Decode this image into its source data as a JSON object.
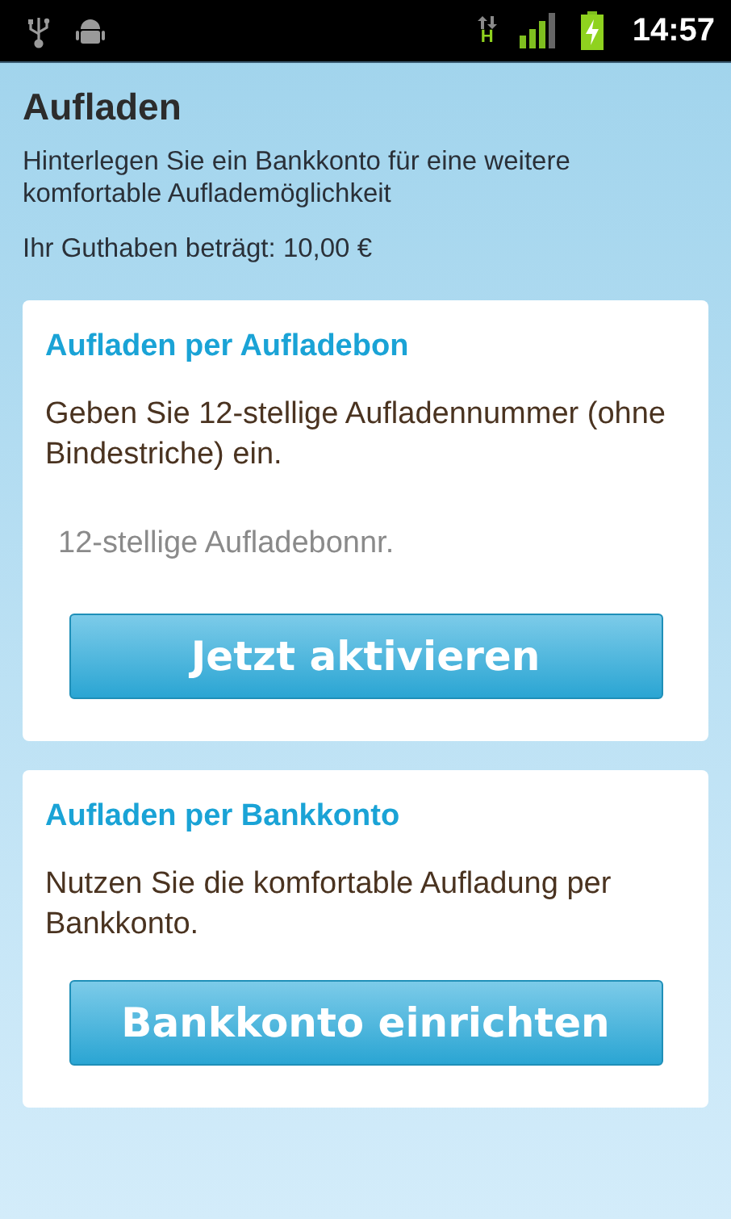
{
  "status_bar": {
    "time": "14:57",
    "network_type": "H"
  },
  "title": "Aufladen",
  "description": "Hinterlegen Sie ein Bankkonto für eine weitere komfortable Auflademöglichkeit",
  "balance": "Ihr Guthaben beträgt: 10,00 €",
  "cards": [
    {
      "title": "Aufladen per Aufladebon",
      "text": "Geben Sie 12-stellige Aufladennummer (ohne Bindestriche) ein.",
      "field": {
        "placeholder": "12-stellige Aufladebonnr."
      },
      "button": "Jetzt aktivieren"
    },
    {
      "title": "Aufladen per Bankkonto",
      "text": "Nutzen Sie die komfortable Aufladung per Bankkonto.",
      "button": "Bankkonto einrichten"
    }
  ]
}
